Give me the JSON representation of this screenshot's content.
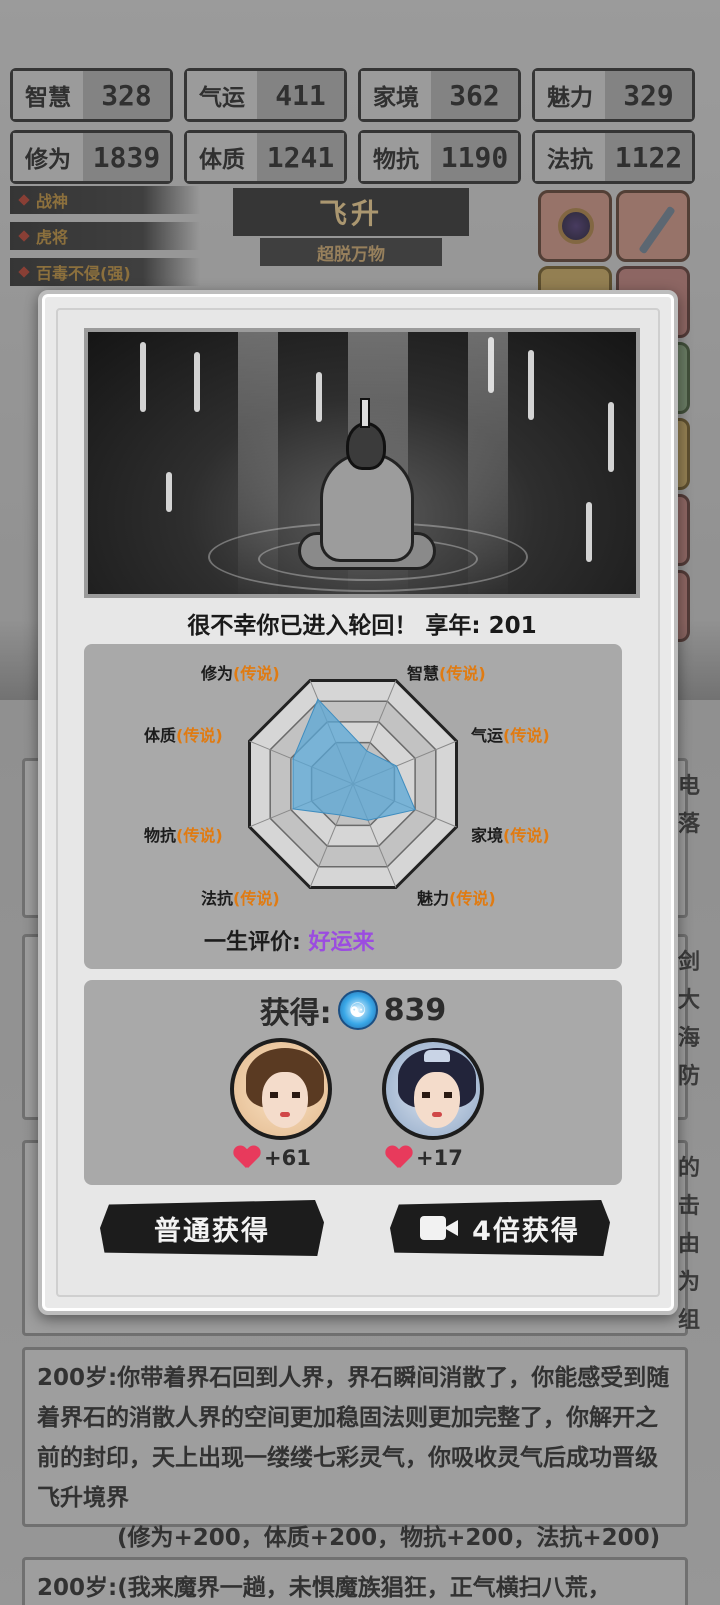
{
  "stats": [
    {
      "name": "智慧",
      "value": "328"
    },
    {
      "name": "气运",
      "value": "411"
    },
    {
      "name": "家境",
      "value": "362"
    },
    {
      "name": "魅力",
      "value": "329"
    },
    {
      "name": "修为",
      "value": "1839"
    },
    {
      "name": "体质",
      "value": "1241"
    },
    {
      "name": "物抗",
      "value": "1190"
    },
    {
      "name": "法抗",
      "value": "1122"
    }
  ],
  "traits": [
    "战神",
    "虎将",
    "百毒不侵(强)"
  ],
  "realm": {
    "title": "飞升",
    "subtitle": "超脱万物"
  },
  "modal": {
    "death_line": "很不幸你已进入轮回！ 享年: 201",
    "radar": {
      "axes": [
        {
          "name": "修为",
          "tier": "(传说)",
          "value": 0.82
        },
        {
          "name": "智慧",
          "tier": "(传说)",
          "value": 0.32
        },
        {
          "name": "气运",
          "tier": "(传说)",
          "value": 0.42
        },
        {
          "name": "家境",
          "tier": "(传说)",
          "value": 0.6
        },
        {
          "name": "魅力",
          "tier": "(传说)",
          "value": 0.35
        },
        {
          "name": "法抗",
          "tier": "(传说)",
          "value": 0.3
        },
        {
          "name": "物抗",
          "tier": "(传说)",
          "value": 0.58
        },
        {
          "name": "体质",
          "tier": "(传说)",
          "value": 0.58
        }
      ],
      "fill_color": "#5aa7d6"
    },
    "evaluation_label": "一生评价:",
    "evaluation_value": "好运来",
    "reward_label": "获得:",
    "reward_amount": "839",
    "companions": [
      {
        "favor": "+61"
      },
      {
        "favor": "+17"
      }
    ],
    "normal_button": "普通获得",
    "video_button": "4倍获得"
  },
  "log": {
    "entry_1": "200岁:你带着界石回到人界，界石瞬间消散了，你能感受到随着界石的消散人界的空间更加稳固法则更加完整了，你解开之前的封印，天上出现一缕缕七彩灵气，你吸收灵气后成功晋级飞升境界",
    "entry_1_bonus": "(修为+200，体质+200，物抗+200，法抗+200)",
    "entry_2": "200岁:(我来魔界一趟，未惧魔族猖狂，正气横扫八荒，",
    "edge_chars_a": "电落",
    "edge_chars_b": "剑大海防",
    "edge_chars_c": "的击由为组"
  },
  "colors": {
    "accent_orange": "#e07b12",
    "eval_purple": "#9b4ce0",
    "heart": "#e83a5c"
  }
}
